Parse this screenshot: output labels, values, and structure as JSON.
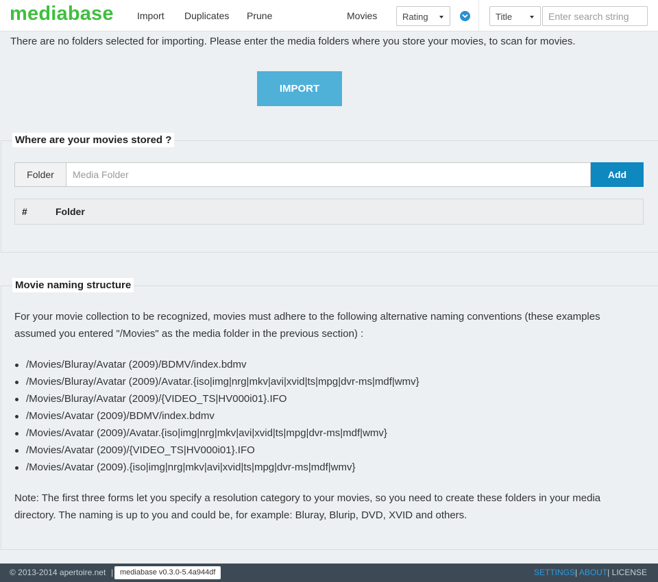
{
  "navbar": {
    "brand": "mediabase",
    "links": [
      "Import",
      "Duplicates",
      "Prune"
    ],
    "movies_label": "Movies",
    "sort_select": "Rating",
    "filter_select": "Title",
    "search_placeholder": "Enter search string"
  },
  "intro": {
    "notice": "There are no folders selected for importing. Please enter the media folders where you store your movies, to scan for movies.",
    "import_button": "IMPORT"
  },
  "storage": {
    "legend": "Where are your movies stored ?",
    "folder_addon": "Folder",
    "folder_placeholder": "Media Folder",
    "add_button": "Add",
    "table_headers": [
      "#",
      "Folder"
    ]
  },
  "naming": {
    "legend": "Movie naming structure",
    "intro": "For your movie collection to be recognized, movies must adhere to the following alternative naming conventions (these examples assumed you entered \"/Movies\" as the media folder in the previous section) :",
    "examples": [
      "/Movies/Bluray/Avatar (2009)/BDMV/index.bdmv",
      "/Movies/Bluray/Avatar (2009)/Avatar.{iso|img|nrg|mkv|avi|xvid|ts|mpg|dvr-ms|mdf|wmv}",
      "/Movies/Bluray/Avatar (2009)/{VIDEO_TS|HV000i01}.IFO",
      "/Movies/Avatar (2009)/BDMV/index.bdmv",
      "/Movies/Avatar (2009)/Avatar.{iso|img|nrg|mkv|avi|xvid|ts|mpg|dvr-ms|mdf|wmv}",
      "/Movies/Avatar (2009)/{VIDEO_TS|HV000i01}.IFO",
      "/Movies/Avatar (2009).{iso|img|nrg|mkv|avi|xvid|ts|mpg|dvr-ms|mdf|wmv}"
    ],
    "note": "Note: The first three forms let you specify a resolution category to your movies, so you need to create these folders in your media directory. The naming is up to you and could be, for example: Bluray, Blurip, DVD, XVID and others."
  },
  "footer": {
    "copyright": "© 2013-2014 apertoire.net",
    "pipe": "|",
    "version": "mediabase v0.3.0-5.4a944df",
    "links": {
      "settings": "SETTINGS",
      "about": "ABOUT",
      "license": "LICENSE",
      "sep": "|"
    }
  },
  "colors": {
    "brand": "#3fbf3f",
    "import_button": "#4fb0d8",
    "add_button": "#0f87bf",
    "footer_bg": "#3d4a55",
    "footer_link": "#2b9ce0"
  },
  "icons": {
    "order_toggle": "chevron-down-circle-icon"
  }
}
